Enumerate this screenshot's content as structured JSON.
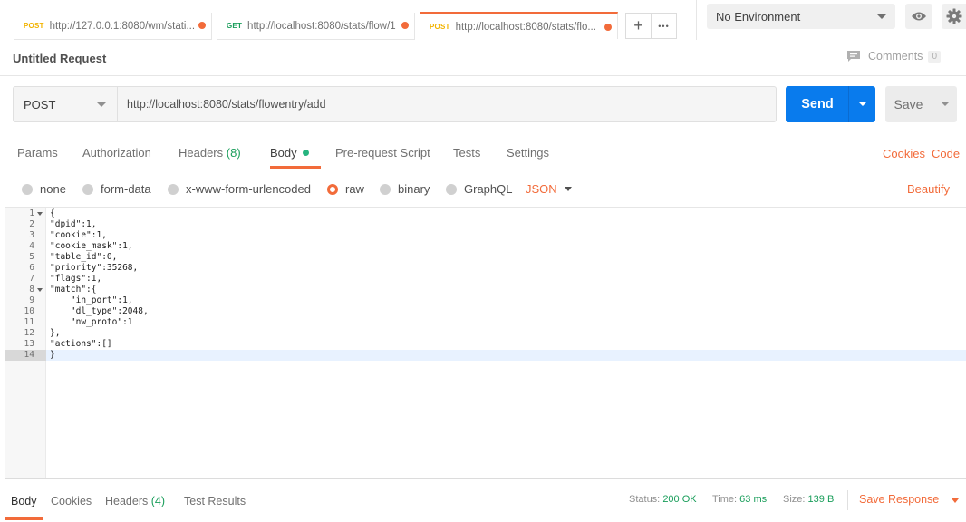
{
  "tabs": [
    {
      "method": "POST",
      "url": "http://127.0.0.1:8080/wm/stati..."
    },
    {
      "method": "GET",
      "url": "http://localhost:8080/stats/flow/1"
    },
    {
      "method": "POST",
      "url": "http://localhost:8080/stats/flo..."
    }
  ],
  "tab_actions": {
    "add": "+",
    "more": "•••"
  },
  "environment": {
    "selected": "No Environment"
  },
  "request": {
    "title": "Untitled Request",
    "comments_label": "Comments",
    "comments_count": "0",
    "method": "POST",
    "url": "http://localhost:8080/stats/flowentry/add",
    "send_label": "Send",
    "save_label": "Save"
  },
  "request_tabs": {
    "params": "Params",
    "authorization": "Authorization",
    "headers": "Headers",
    "headers_count": "(8)",
    "body": "Body",
    "prerequest": "Pre-request Script",
    "tests": "Tests",
    "settings": "Settings",
    "cookies": "Cookies",
    "code": "Code"
  },
  "body_types": {
    "none": "none",
    "form_data": "form-data",
    "urlencoded": "x-www-form-urlencoded",
    "raw": "raw",
    "binary": "binary",
    "graphql": "GraphQL",
    "format": "JSON",
    "beautify": "Beautify"
  },
  "code_lines": [
    "{",
    "\"dpid\":1,",
    "\"cookie\":1,",
    "\"cookie_mask\":1,",
    "\"table_id\":0,",
    "\"priority\":35268,",
    "\"flags\":1,",
    "\"match\":{",
    "    \"in_port\":1,",
    "    \"dl_type\":2048,",
    "    \"nw_proto\":1",
    "},",
    "\"actions\":[]",
    "}"
  ],
  "response": {
    "tabs": {
      "body": "Body",
      "cookies": "Cookies",
      "headers": "Headers",
      "headers_count": "(4)",
      "test_results": "Test Results"
    },
    "status_label": "Status:",
    "status_value": "200 OK",
    "time_label": "Time:",
    "time_value": "63 ms",
    "size_label": "Size:",
    "size_value": "139 B",
    "save_label": "Save Response"
  },
  "colors": {
    "accent": "#f26b3a",
    "primary": "#097bed",
    "success": "#1a9e5b"
  }
}
